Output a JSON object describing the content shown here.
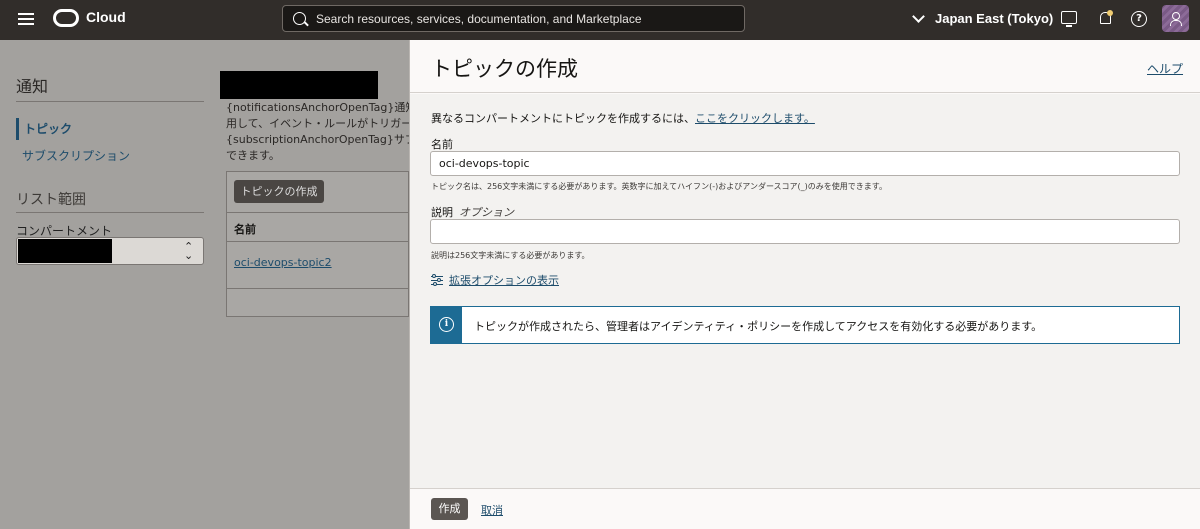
{
  "header": {
    "app_name": "Cloud",
    "search_placeholder": "Search resources, services, documentation, and Marketplace",
    "region": "Japan East (Tokyo)"
  },
  "background": {
    "nav_title": "通知",
    "nav_items": [
      "トピック",
      "サブスクリプション"
    ],
    "scope_title": "リスト範囲",
    "compartment_label": "コンパートメント",
    "description_lines": [
      "{notificationsAnchorOpenTag}通知サー",
      "用して、イベント・ルールがトリガーさ",
      "{subscriptionAnchorOpenTag}サブスク",
      "できます。"
    ],
    "create_topic_button": "トピックの作成",
    "table_header_name": "名前",
    "table_rows": [
      "oci-devops-topic2"
    ]
  },
  "panel": {
    "title": "トピックの作成",
    "help_link": "ヘルプ",
    "intro_text": "異なるコンパートメントにトピックを作成するには、",
    "intro_link": "ここをクリックします。",
    "name_label": "名前",
    "name_value": "oci-devops-topic",
    "name_hint": "トピック名は、256文字未満にする必要があります。英数字に加えてハイフン(-)およびアンダースコア(_)のみを使用できます。",
    "description_label": "説明",
    "description_optional": "オプション",
    "description_value": "",
    "description_hint": "説明は256文字未満にする必要があります。",
    "advanced_options": "拡張オプションの表示",
    "info_message": "トピックが作成されたら、管理者はアイデンティティ・ポリシーを作成してアクセスを有効化する必要があります。",
    "create_button": "作成",
    "cancel_button": "取消"
  },
  "colors": {
    "header_bg": "#312d2a",
    "link": "#1d4c6b",
    "info_accent": "#1d6b94",
    "primary_button": "#5b5652"
  }
}
